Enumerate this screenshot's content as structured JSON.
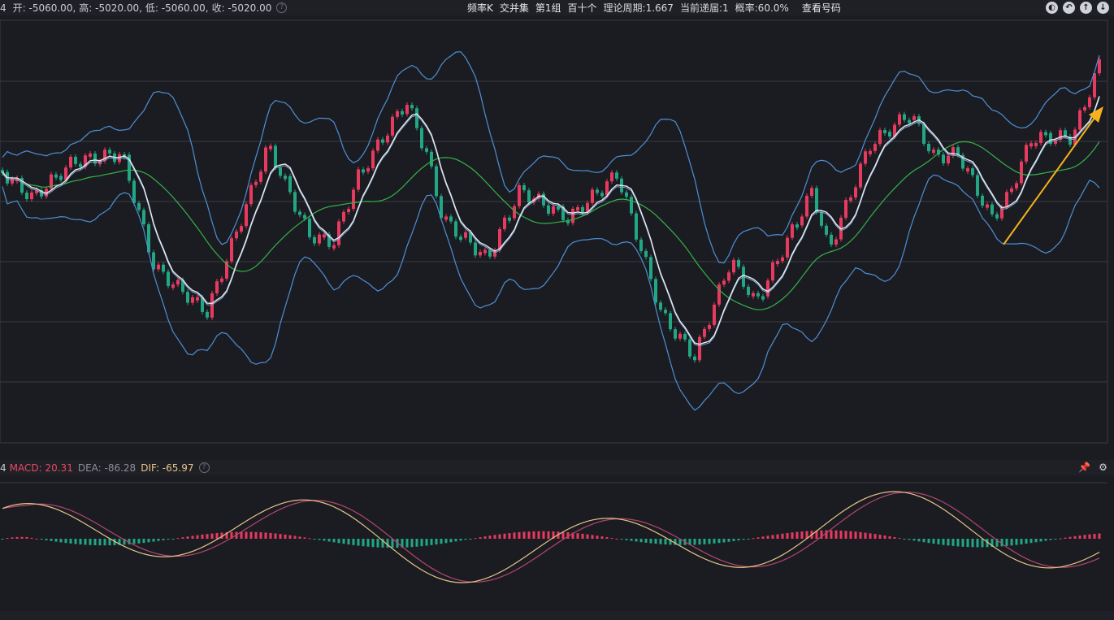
{
  "kline_header": {
    "prefix": "4",
    "open": "开: -5060.00,",
    "high": "高: -5020.00,",
    "low": "低: -5060.00,",
    "close": "收: -5020.00",
    "freq_k": "频率K",
    "alternate_set": "交并集",
    "group": "第1组",
    "hundred_ten": "百十个",
    "theory_cycle": "理论周期:1.667",
    "current_progress": "当前递届:1",
    "probability": "概率:60.0%",
    "view_number": "查看号码"
  },
  "macd_header": {
    "prefix": "4",
    "macd": "MACD: 20.31",
    "dea": "DEA: -86.28",
    "dif": "DIF: -65.97"
  },
  "colors": {
    "up": "#e83a5f",
    "down": "#21a784",
    "boll": "#4d8fd6",
    "ma_white": "#e8eaee",
    "ma_green": "#35b24a",
    "arrow": "#f5b21a",
    "grid": "#3a3c44",
    "dif": "#e5c48a",
    "dea": "#b4466f"
  },
  "icons": [
    "eye-icon",
    "undo-icon",
    "up-icon",
    "down-icon"
  ]
}
